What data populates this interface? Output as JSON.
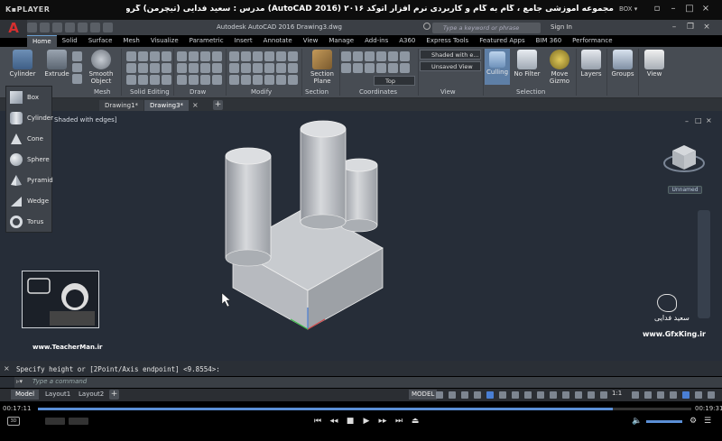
{
  "player": {
    "logo": "K▪PLAYER",
    "title": "مجموعه آموزشی جامع ، گام به گام و کاربردی نرم افزار اتوکد ۲۰۱۶ (AutoCAD 2016) مدرس : سعید فدایی (تیچرمن) گروه آموزشی پادشاه گرافیست ها",
    "box_label": "BOX ▾",
    "time_elapsed": "00:17:11",
    "time_total": "00:19:31",
    "progress": 0.88
  },
  "acad": {
    "logo": "A",
    "title": "Autodesk AutoCAD 2016     Drawing3.dwg",
    "search_placeholder": "Type a keyword or phrase",
    "signin": "Sign In",
    "tabs": [
      "Home",
      "Solid",
      "Surface",
      "Mesh",
      "Visualize",
      "Parametric",
      "Insert",
      "Annotate",
      "View",
      "Manage",
      "Add-ins",
      "A360",
      "Express Tools",
      "Featured Apps",
      "BIM 360",
      "Performance"
    ],
    "active_tab": "Home"
  },
  "ribbon": {
    "cylinder": "Cylinder",
    "extrude": "Extrude",
    "smooth_object": "Smooth Object",
    "section_plane": "Section Plane",
    "culling": "Culling",
    "no_filter": "No Filter",
    "move_gizmo": "Move Gizmo",
    "layers": "Layers",
    "groups": "Groups",
    "view": "View",
    "visual_style": "Shaded with e...",
    "unsaved_view": "Unsaved View",
    "top_view": "Top",
    "panels": {
      "mesh": "Mesh",
      "solid_editing": "Solid Editing",
      "draw": "Draw",
      "modify": "Modify",
      "section": "Section",
      "coordinates": "Coordinates",
      "view": "View",
      "selection": "Selection"
    }
  },
  "doc_tabs": [
    "Drawing1*",
    "Drawing3*"
  ],
  "viewport": {
    "label": "Shaded with edges]",
    "unnamed": "Unnamed"
  },
  "dropdown": [
    {
      "label": "Box"
    },
    {
      "label": "Cylinder"
    },
    {
      "label": "Cone"
    },
    {
      "label": "Sphere"
    },
    {
      "label": "Pyramid"
    },
    {
      "label": "Wedge"
    },
    {
      "label": "Torus"
    }
  ],
  "command": {
    "history": "Specify height or [2Point/Axis endpoint] <9.8554>:",
    "placeholder": "Type a command"
  },
  "layout_tabs": [
    "Model",
    "Layout1",
    "Layout2"
  ],
  "status": {
    "model": "MODEL",
    "scale": "1:1"
  },
  "watermark": {
    "teacherman_url": "www.TeacherMan.ir",
    "gfx_name": "سعید فدایی",
    "gfx_url": "www.GfxKing.ir"
  },
  "colors": {
    "viewport_bg": "#262d38",
    "ribbon_bg": "#474c53",
    "accent": "#6a9ed1"
  }
}
